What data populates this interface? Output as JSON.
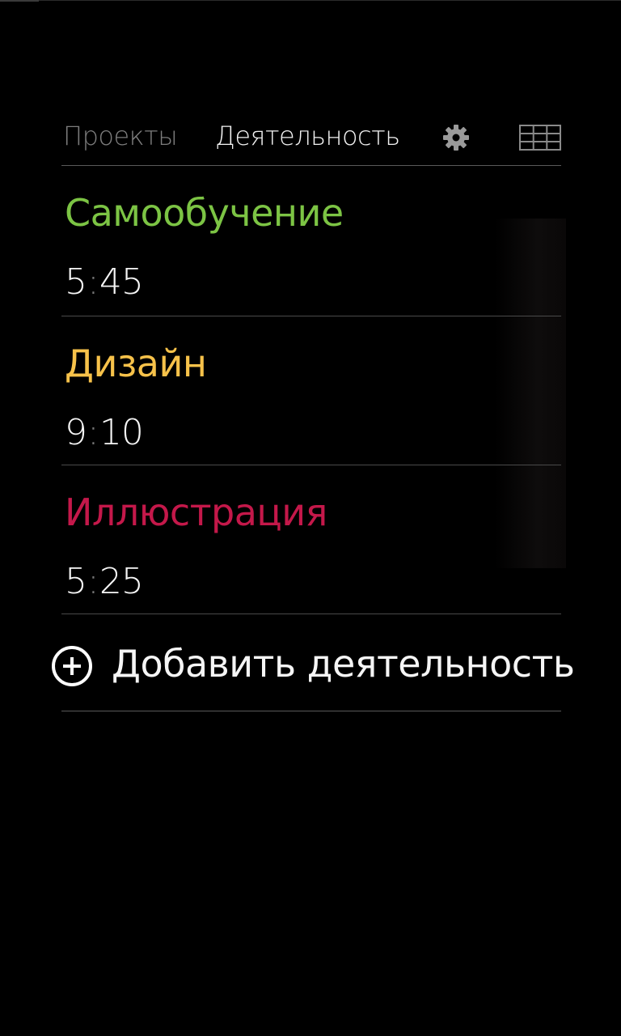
{
  "header": {
    "tabs": [
      {
        "label": "Проекты",
        "active": false
      },
      {
        "label": "Деятельность",
        "active": true
      }
    ],
    "icons": [
      "gear-icon",
      "grid-view-icon"
    ]
  },
  "activities": [
    {
      "name": "Самообучение",
      "hours": "5",
      "minutes": "45",
      "color": "#7cc444"
    },
    {
      "name": "Дизайн",
      "hours": "9",
      "minutes": "10",
      "color": "#f7c24a"
    },
    {
      "name": "Иллюстрация",
      "hours": "5",
      "minutes": "25",
      "color": "#c4184a"
    }
  ],
  "add_activity": {
    "label": "Добавить деятельность",
    "icon": "plus-circle-icon"
  },
  "colors": {
    "background": "#000000",
    "inactive_tab": "#7d7d7d",
    "active_tab": "#f2f2f2",
    "divider": "#4a4a4a",
    "time_separator": "#777777"
  }
}
